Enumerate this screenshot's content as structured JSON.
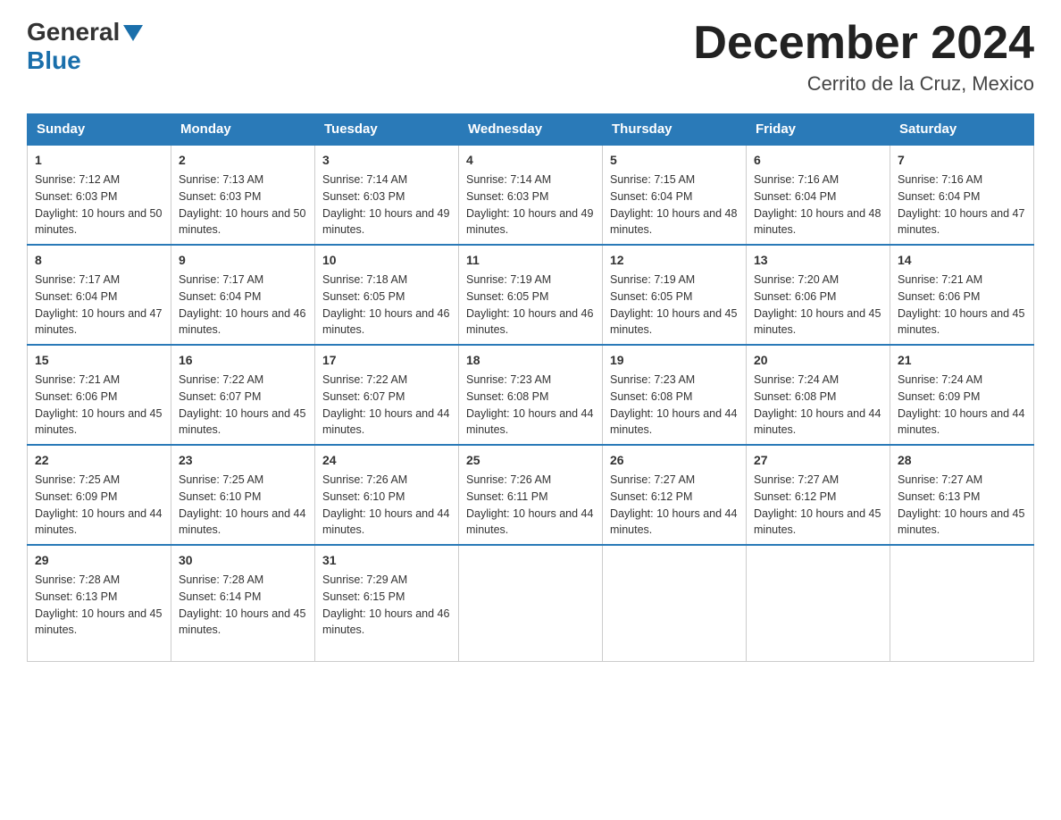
{
  "header": {
    "logo_general": "General",
    "logo_blue": "Blue",
    "month_title": "December 2024",
    "location": "Cerrito de la Cruz, Mexico"
  },
  "weekdays": [
    "Sunday",
    "Monday",
    "Tuesday",
    "Wednesday",
    "Thursday",
    "Friday",
    "Saturday"
  ],
  "weeks": [
    [
      {
        "day": "1",
        "sunrise": "7:12 AM",
        "sunset": "6:03 PM",
        "daylight": "10 hours and 50 minutes."
      },
      {
        "day": "2",
        "sunrise": "7:13 AM",
        "sunset": "6:03 PM",
        "daylight": "10 hours and 50 minutes."
      },
      {
        "day": "3",
        "sunrise": "7:14 AM",
        "sunset": "6:03 PM",
        "daylight": "10 hours and 49 minutes."
      },
      {
        "day": "4",
        "sunrise": "7:14 AM",
        "sunset": "6:03 PM",
        "daylight": "10 hours and 49 minutes."
      },
      {
        "day": "5",
        "sunrise": "7:15 AM",
        "sunset": "6:04 PM",
        "daylight": "10 hours and 48 minutes."
      },
      {
        "day": "6",
        "sunrise": "7:16 AM",
        "sunset": "6:04 PM",
        "daylight": "10 hours and 48 minutes."
      },
      {
        "day": "7",
        "sunrise": "7:16 AM",
        "sunset": "6:04 PM",
        "daylight": "10 hours and 47 minutes."
      }
    ],
    [
      {
        "day": "8",
        "sunrise": "7:17 AM",
        "sunset": "6:04 PM",
        "daylight": "10 hours and 47 minutes."
      },
      {
        "day": "9",
        "sunrise": "7:17 AM",
        "sunset": "6:04 PM",
        "daylight": "10 hours and 46 minutes."
      },
      {
        "day": "10",
        "sunrise": "7:18 AM",
        "sunset": "6:05 PM",
        "daylight": "10 hours and 46 minutes."
      },
      {
        "day": "11",
        "sunrise": "7:19 AM",
        "sunset": "6:05 PM",
        "daylight": "10 hours and 46 minutes."
      },
      {
        "day": "12",
        "sunrise": "7:19 AM",
        "sunset": "6:05 PM",
        "daylight": "10 hours and 45 minutes."
      },
      {
        "day": "13",
        "sunrise": "7:20 AM",
        "sunset": "6:06 PM",
        "daylight": "10 hours and 45 minutes."
      },
      {
        "day": "14",
        "sunrise": "7:21 AM",
        "sunset": "6:06 PM",
        "daylight": "10 hours and 45 minutes."
      }
    ],
    [
      {
        "day": "15",
        "sunrise": "7:21 AM",
        "sunset": "6:06 PM",
        "daylight": "10 hours and 45 minutes."
      },
      {
        "day": "16",
        "sunrise": "7:22 AM",
        "sunset": "6:07 PM",
        "daylight": "10 hours and 45 minutes."
      },
      {
        "day": "17",
        "sunrise": "7:22 AM",
        "sunset": "6:07 PM",
        "daylight": "10 hours and 44 minutes."
      },
      {
        "day": "18",
        "sunrise": "7:23 AM",
        "sunset": "6:08 PM",
        "daylight": "10 hours and 44 minutes."
      },
      {
        "day": "19",
        "sunrise": "7:23 AM",
        "sunset": "6:08 PM",
        "daylight": "10 hours and 44 minutes."
      },
      {
        "day": "20",
        "sunrise": "7:24 AM",
        "sunset": "6:08 PM",
        "daylight": "10 hours and 44 minutes."
      },
      {
        "day": "21",
        "sunrise": "7:24 AM",
        "sunset": "6:09 PM",
        "daylight": "10 hours and 44 minutes."
      }
    ],
    [
      {
        "day": "22",
        "sunrise": "7:25 AM",
        "sunset": "6:09 PM",
        "daylight": "10 hours and 44 minutes."
      },
      {
        "day": "23",
        "sunrise": "7:25 AM",
        "sunset": "6:10 PM",
        "daylight": "10 hours and 44 minutes."
      },
      {
        "day": "24",
        "sunrise": "7:26 AM",
        "sunset": "6:10 PM",
        "daylight": "10 hours and 44 minutes."
      },
      {
        "day": "25",
        "sunrise": "7:26 AM",
        "sunset": "6:11 PM",
        "daylight": "10 hours and 44 minutes."
      },
      {
        "day": "26",
        "sunrise": "7:27 AM",
        "sunset": "6:12 PM",
        "daylight": "10 hours and 44 minutes."
      },
      {
        "day": "27",
        "sunrise": "7:27 AM",
        "sunset": "6:12 PM",
        "daylight": "10 hours and 45 minutes."
      },
      {
        "day": "28",
        "sunrise": "7:27 AM",
        "sunset": "6:13 PM",
        "daylight": "10 hours and 45 minutes."
      }
    ],
    [
      {
        "day": "29",
        "sunrise": "7:28 AM",
        "sunset": "6:13 PM",
        "daylight": "10 hours and 45 minutes."
      },
      {
        "day": "30",
        "sunrise": "7:28 AM",
        "sunset": "6:14 PM",
        "daylight": "10 hours and 45 minutes."
      },
      {
        "day": "31",
        "sunrise": "7:29 AM",
        "sunset": "6:15 PM",
        "daylight": "10 hours and 46 minutes."
      },
      null,
      null,
      null,
      null
    ]
  ]
}
